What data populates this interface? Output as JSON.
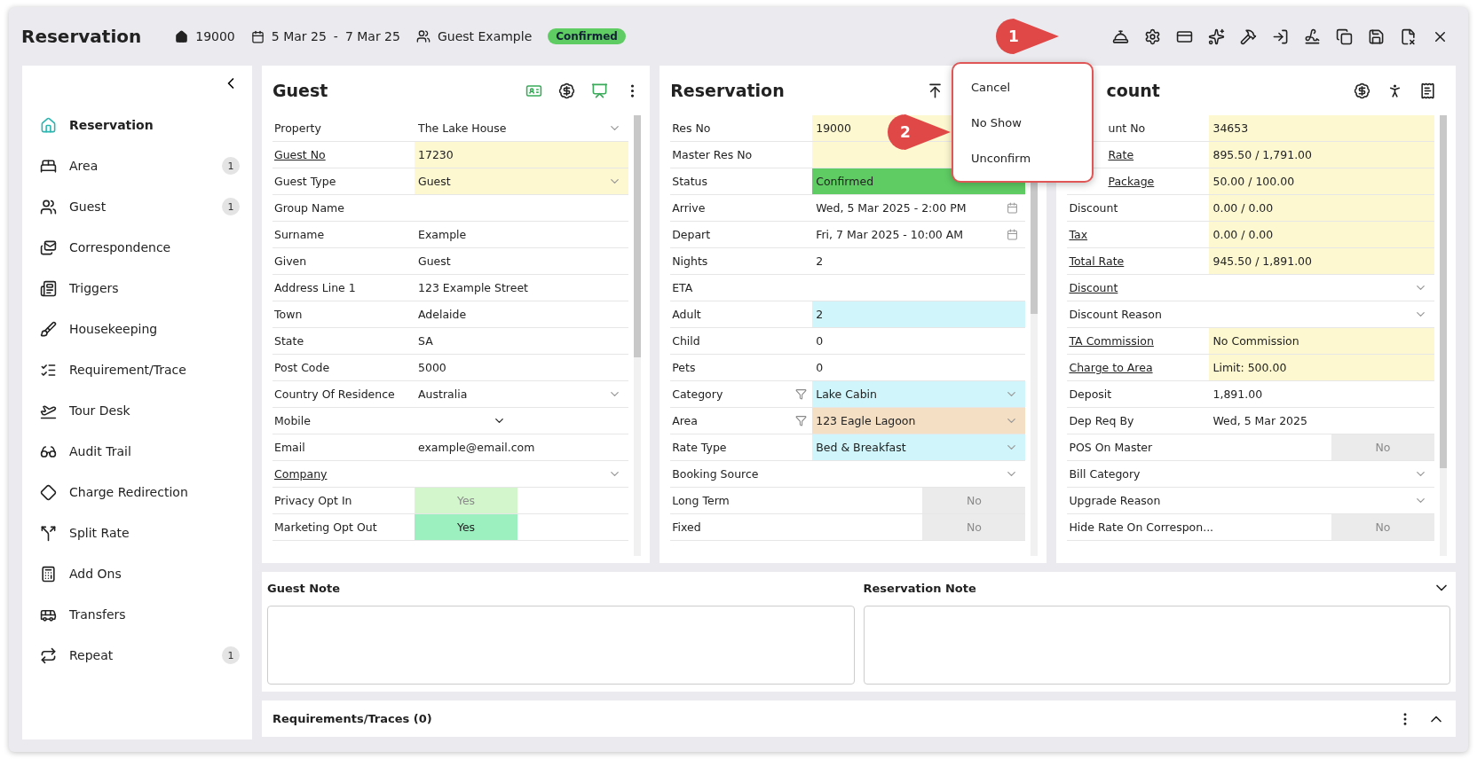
{
  "header": {
    "title": "Reservation",
    "res_no": "19000",
    "arrive": "5 Mar 25",
    "separator": "-",
    "depart": "7 Mar 25",
    "guest": "Guest Example",
    "status": "Confirmed",
    "callout": "1"
  },
  "sidebar": {
    "items": [
      {
        "label": "Reservation",
        "selected": true
      },
      {
        "label": "Area",
        "selected": false,
        "count": "1"
      },
      {
        "label": "Guest",
        "selected": false,
        "count": "1"
      },
      {
        "label": "Correspondence",
        "selected": false
      },
      {
        "label": "Triggers",
        "selected": false
      },
      {
        "label": "Housekeeping",
        "selected": false
      },
      {
        "label": "Requirement/Trace",
        "selected": false
      },
      {
        "label": "Tour Desk",
        "selected": false
      },
      {
        "label": "Audit Trail",
        "selected": false
      },
      {
        "label": "Charge Redirection",
        "selected": false
      },
      {
        "label": "Split Rate",
        "selected": false
      },
      {
        "label": "Add Ons",
        "selected": false
      },
      {
        "label": "Transfers",
        "selected": false
      },
      {
        "label": "Repeat",
        "selected": false,
        "count": "1"
      }
    ]
  },
  "guest": {
    "title": "Guest",
    "fields": [
      {
        "kind": "select",
        "label": "Property",
        "value": "The Lake House"
      },
      {
        "kind": "text",
        "label": "Guest No",
        "link": true,
        "value": "17230",
        "color": "#fdf8d0"
      },
      {
        "kind": "select",
        "label": "Guest Type",
        "value": "Guest",
        "color": "#fdf8d0"
      },
      {
        "kind": "text",
        "label": "Group Name"
      },
      {
        "kind": "text",
        "label": "Surname",
        "value": "Example"
      },
      {
        "kind": "text",
        "label": "Given",
        "value": "Guest"
      },
      {
        "kind": "text",
        "label": "Address Line 1",
        "value": "123 Example Street"
      },
      {
        "kind": "text",
        "label": "Town",
        "value": "Adelaide"
      },
      {
        "kind": "text",
        "label": "State",
        "value": "SA"
      },
      {
        "kind": "text",
        "label": "Post Code",
        "value": "5000"
      },
      {
        "kind": "select",
        "label": "Country Of Residence",
        "value": "Australia"
      },
      {
        "kind": "phone",
        "label": "Mobile"
      },
      {
        "kind": "text",
        "label": "Email",
        "value": "example@email.com"
      },
      {
        "kind": "select",
        "label": "Company",
        "link": true
      },
      {
        "kind": "toggle",
        "label": "Privacy Opt In",
        "value": "Yes",
        "color": "#d3f6cd",
        "disabled": true
      },
      {
        "kind": "toggle",
        "label": "Marketing Opt Out",
        "value": "Yes",
        "color": "#9cf0c0",
        "disabled": false
      }
    ]
  },
  "reservation": {
    "title": "Reservation",
    "callout": "2",
    "fields": [
      {
        "kind": "text",
        "label": "Res No",
        "value": "19000",
        "color": "#fdf8d0"
      },
      {
        "kind": "text",
        "label": "Master Res No",
        "color": "#fdf8d0"
      },
      {
        "kind": "text",
        "label": "Status",
        "value": "Confirmed",
        "color": "#5fcc63"
      },
      {
        "kind": "date",
        "label": "Arrive",
        "value": "Wed, 5 Mar 2025 - 2:00 PM"
      },
      {
        "kind": "date",
        "label": "Depart",
        "value": "Fri, 7 Mar 2025 - 10:00 AM"
      },
      {
        "kind": "text",
        "label": "Nights",
        "value": "2"
      },
      {
        "kind": "text",
        "label": "ETA"
      },
      {
        "kind": "text",
        "label": "Adult",
        "value": "2",
        "color": "#d0f5fa"
      },
      {
        "kind": "text",
        "label": "Child",
        "value": "0"
      },
      {
        "kind": "text",
        "label": "Pets",
        "value": "0"
      },
      {
        "kind": "select",
        "label": "Category",
        "filter": true,
        "value": "Lake Cabin",
        "color": "#d0f5fa"
      },
      {
        "kind": "select",
        "label": "Area",
        "filter": true,
        "value": "123 Eagle Lagoon",
        "color": "#f4dfc5"
      },
      {
        "kind": "select",
        "label": "Rate Type",
        "value": "Bed & Breakfast",
        "color": "#d0f5fa"
      },
      {
        "kind": "select",
        "label": "Booking Source"
      },
      {
        "kind": "toggle",
        "label": "Long Term",
        "value": "No",
        "color": "#ebebeb",
        "disabled": true
      },
      {
        "kind": "toggle",
        "label": "Fixed",
        "value": "No",
        "color": "#ebebeb",
        "disabled": true
      }
    ]
  },
  "menu": {
    "items": [
      "Cancel",
      "No Show",
      "Unconfirm"
    ]
  },
  "account": {
    "title": "count",
    "title_cut": true,
    "fields": [
      {
        "kind": "text",
        "label": "unt No",
        "cut": true,
        "value": "34653",
        "color": "#fdf8d0"
      },
      {
        "kind": "text",
        "label": "Rate",
        "cut": true,
        "link": true,
        "value": "895.50 / 1,791.00",
        "color": "#fdf8d0"
      },
      {
        "kind": "text",
        "label": "Package",
        "cut": true,
        "link": true,
        "value": "50.00 / 100.00",
        "color": "#fdf8d0"
      },
      {
        "kind": "text",
        "label": "Discount",
        "value": "0.00 / 0.00",
        "color": "#fdf8d0"
      },
      {
        "kind": "text",
        "label": "Tax",
        "link": true,
        "value": "0.00 / 0.00",
        "color": "#fdf8d0"
      },
      {
        "kind": "text",
        "label": "Total Rate",
        "link": true,
        "value": "945.50 / 1,891.00",
        "color": "#fdf8d0"
      },
      {
        "kind": "select",
        "label": "Discount",
        "link": true
      },
      {
        "kind": "select",
        "label": "Discount Reason"
      },
      {
        "kind": "text",
        "label": "TA Commission",
        "link": true,
        "value": "No Commission",
        "color": "#fdf8d0"
      },
      {
        "kind": "text",
        "label": "Charge to Area",
        "link": true,
        "value": "Limit: 500.00",
        "color": "#fdf8d0"
      },
      {
        "kind": "text",
        "label": "Deposit",
        "value": "1,891.00"
      },
      {
        "kind": "text",
        "label": "Dep Req By",
        "value": "Wed, 5 Mar 2025"
      },
      {
        "kind": "toggle",
        "label": "POS On Master",
        "value": "No",
        "color": "#ebebeb",
        "disabled": true
      },
      {
        "kind": "select",
        "label": "Bill Category"
      },
      {
        "kind": "select",
        "label": "Upgrade Reason"
      },
      {
        "kind": "toggle",
        "label": "Hide Rate On Correspon...",
        "value": "No",
        "color": "#ebebeb",
        "disabled": true
      }
    ]
  },
  "notes": {
    "guest_note": "Guest Note",
    "reservation_note": "Reservation Note"
  },
  "requirements": {
    "title": "Requirements/Traces (0)"
  }
}
